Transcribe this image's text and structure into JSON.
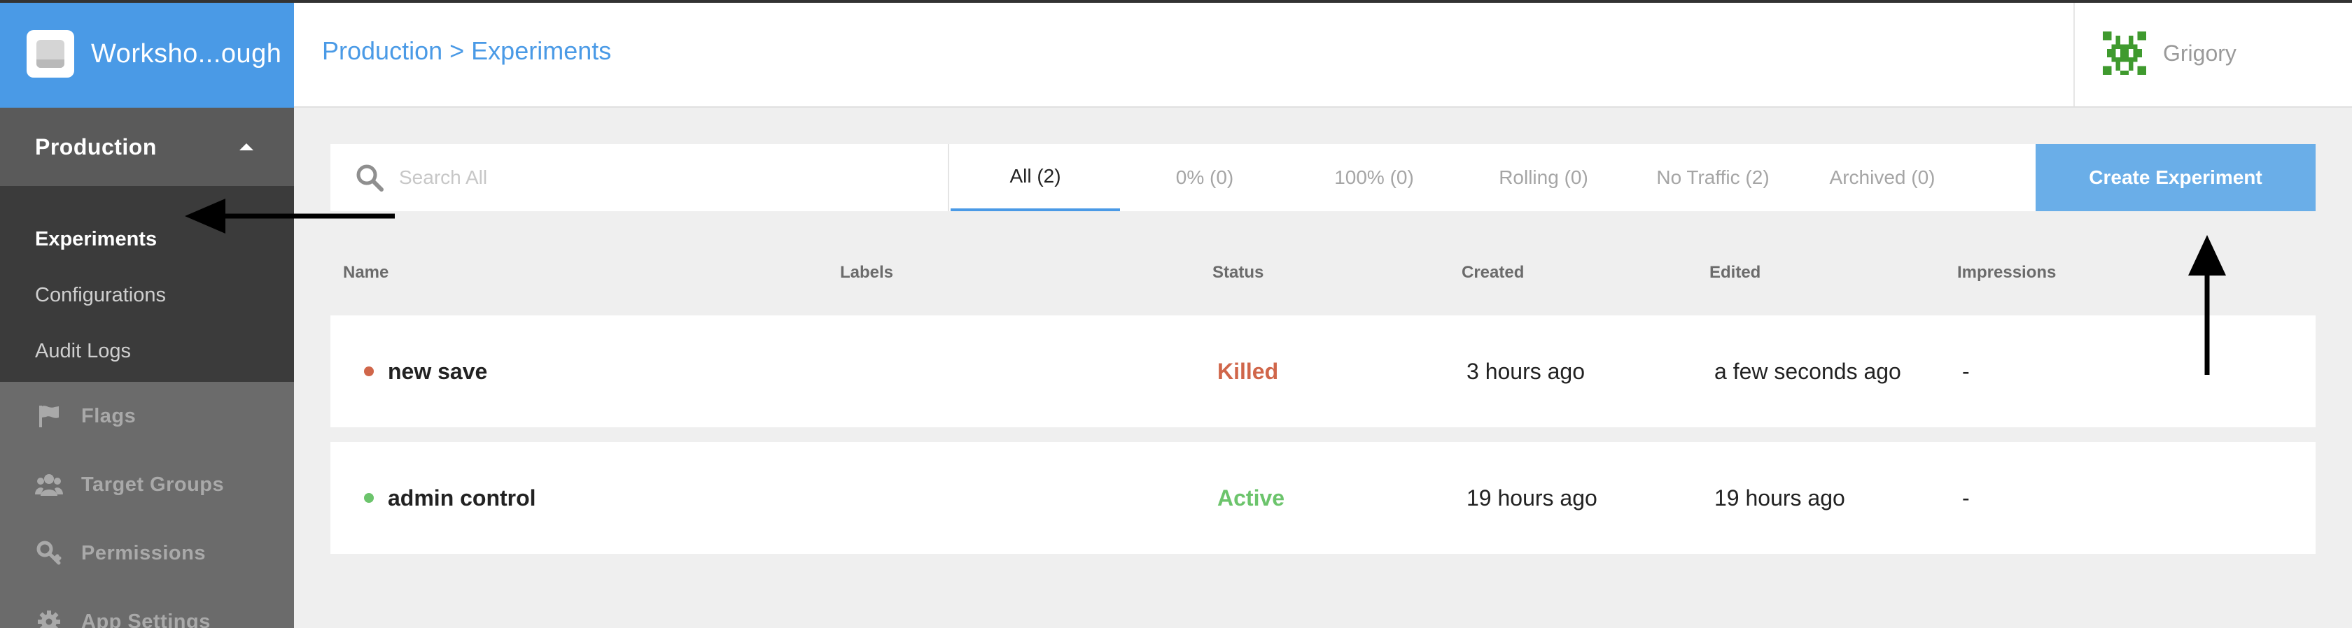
{
  "app": {
    "name": "Worksho...ough",
    "environment": "Production"
  },
  "env_subnav": [
    {
      "label": "Experiments",
      "active": true
    },
    {
      "label": "Configurations",
      "active": false
    },
    {
      "label": "Audit Logs",
      "active": false
    }
  ],
  "main_nav": [
    {
      "label": "Flags",
      "icon": "flag-icon"
    },
    {
      "label": "Target Groups",
      "icon": "users-icon"
    },
    {
      "label": "Permissions",
      "icon": "key-icon"
    },
    {
      "label": "App Settings",
      "icon": "gear-icon"
    }
  ],
  "header": {
    "breadcrumb_env": "Production",
    "breadcrumb_sep": ">",
    "breadcrumb_page": "Experiments",
    "user_name": "Grigory"
  },
  "toolbar": {
    "search_placeholder": "Search All",
    "tabs": [
      {
        "label": "All (2)",
        "active": true
      },
      {
        "label": "0% (0)",
        "active": false
      },
      {
        "label": "100% (0)",
        "active": false
      },
      {
        "label": "Rolling (0)",
        "active": false
      },
      {
        "label": "No Traffic (2)",
        "active": false
      },
      {
        "label": "Archived (0)",
        "active": false
      }
    ],
    "create_label": "Create Experiment"
  },
  "table": {
    "columns": [
      "Name",
      "Labels",
      "Status",
      "Created",
      "Edited",
      "Impressions"
    ],
    "rows": [
      {
        "name": "new save",
        "labels": "",
        "status": "Killed",
        "created": "3 hours ago",
        "edited": "a few seconds ago",
        "impressions": "-",
        "dot_color": "#d0664a",
        "status_color": "#d0664a"
      },
      {
        "name": "admin control",
        "labels": "",
        "status": "Active",
        "created": "19 hours ago",
        "edited": "19 hours ago",
        "impressions": "-",
        "dot_color": "#6cc46c",
        "status_color": "#6cc46c"
      }
    ]
  },
  "colors": {
    "accent": "#4a9ae6",
    "button": "#6aaee8",
    "sidebar": "#6b6b6b",
    "sidebar_dark": "#3b3b3b"
  }
}
